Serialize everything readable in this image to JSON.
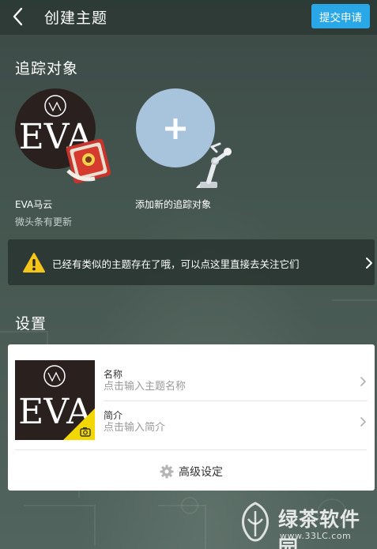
{
  "header": {
    "title": "创建主题",
    "submit_label": "提交申请"
  },
  "track": {
    "section_title": "追踪对象",
    "items": [
      {
        "logo_text": "EVA",
        "name": "EVA马云",
        "subtitle": "微头条有更新"
      }
    ],
    "add_label": "添加新的追踪对象"
  },
  "notice": {
    "text": "已经有类似的主题存在了哦，可以点这里直接去关注它们"
  },
  "settings": {
    "section_title": "设置",
    "logo_text": "EVA",
    "name_label": "名称",
    "name_placeholder": "点击输入主题名称",
    "intro_label": "简介",
    "intro_placeholder": "点击输入简介",
    "advanced_label": "高级设定"
  },
  "watermark": {
    "title": "绿茶软件园",
    "url": "www.33LC.com"
  },
  "colors": {
    "accent": "#29a7e6",
    "warning": "#f5c518",
    "add_circle": "#a8c3dc",
    "background": "#44554f"
  },
  "icons": [
    "back-icon",
    "book-icon",
    "plus-icon",
    "robot-arm-icon",
    "warning-icon",
    "chevron-right-icon",
    "camera-icon",
    "gear-icon",
    "leaf-logo-icon"
  ]
}
